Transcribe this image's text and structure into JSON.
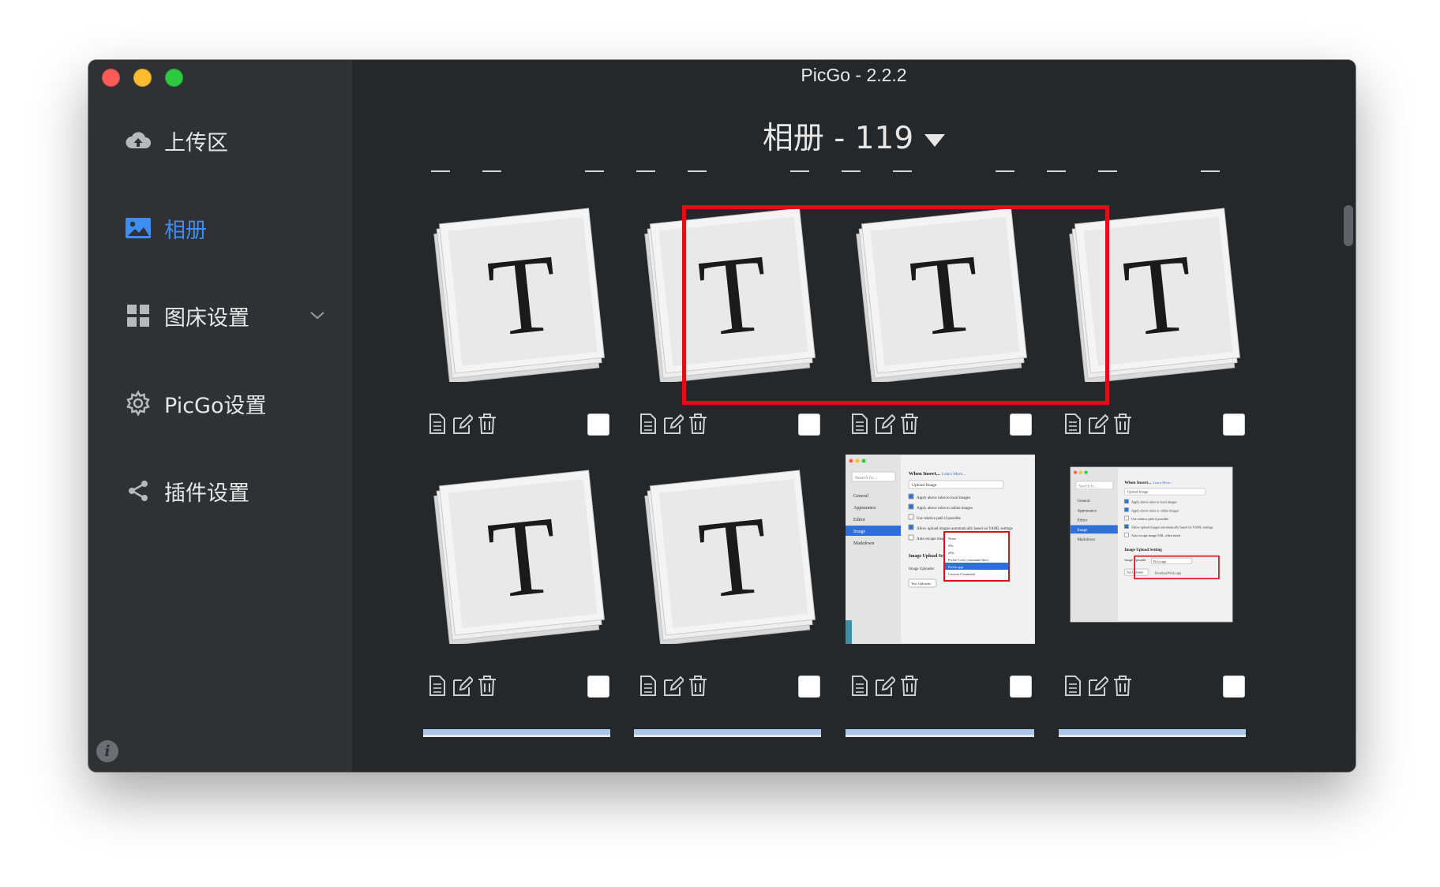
{
  "window": {
    "title": "PicGo - 2.2.2"
  },
  "sidebar": {
    "items": [
      {
        "label": "上传区",
        "icon": "cloud-upload-icon"
      },
      {
        "label": "相册",
        "icon": "image-gallery-icon",
        "active": true
      },
      {
        "label": "图床设置",
        "icon": "grid-icon",
        "expandable": true
      },
      {
        "label": "PicGo设置",
        "icon": "gear-icon"
      },
      {
        "label": "插件设置",
        "icon": "share-icon"
      }
    ],
    "info_icon": "info-icon"
  },
  "album": {
    "title": "相册 - 119",
    "dropdown_icon": "caret-down-icon"
  },
  "gallery": {
    "rows": [
      [
        {
          "kind": "typora-icon",
          "letter": "T"
        },
        {
          "kind": "typora-icon",
          "letter": "T"
        },
        {
          "kind": "typora-icon",
          "letter": "T"
        },
        {
          "kind": "typora-icon",
          "letter": "T"
        }
      ],
      [
        {
          "kind": "typora-icon",
          "letter": "T"
        },
        {
          "kind": "typora-icon",
          "letter": "T"
        },
        {
          "kind": "settings-screenshot"
        },
        {
          "kind": "settings-screenshot-small"
        }
      ]
    ],
    "item_actions": [
      "copy-link-icon",
      "edit-icon",
      "delete-icon"
    ],
    "selection_highlight": "#e00d1a"
  },
  "screenshot_labels": {
    "search": "Search fo...",
    "sidebar": [
      "General",
      "Appearance",
      "Editor",
      "Image",
      "Markdown"
    ],
    "when_insert": "When Insert...",
    "learn_more": "Learn More...",
    "upload_image": "Upload Image",
    "options": [
      "Apply above rules to local images",
      "Apply above rules to online images",
      "Use relative path if possible",
      "Allow upload images automatically based on YAML settings",
      "Auto escape image URL when insert"
    ],
    "upload_setting": "Image Upload Setting",
    "uploader_label": "Image Uploader",
    "uploader_value": "PicGo.app",
    "test_uploader": "Test Uploader",
    "download_picgo": "Download PicGo.app",
    "dropdown_options": [
      "None",
      "iPic",
      "uPic",
      "PicGo Core (command line)",
      "PicGo.app",
      "Custom Command"
    ]
  },
  "colors": {
    "accent": "#3d8ef0",
    "sidebar_bg": "#2f3135",
    "main_bg": "#25282b",
    "highlight": "#e00d1a"
  }
}
